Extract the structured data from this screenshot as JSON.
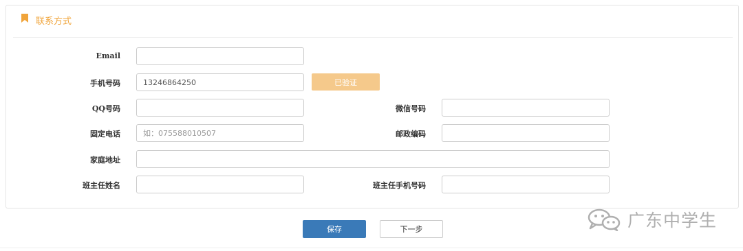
{
  "section": {
    "title": "联系方式",
    "icon": "bookmark-icon",
    "accent_color": "#f0a43a"
  },
  "form": {
    "email": {
      "label": "Email",
      "value": "",
      "placeholder": ""
    },
    "mobile": {
      "label": "手机号码",
      "value": "13246864250",
      "placeholder": ""
    },
    "verify_button": {
      "label": "已验证",
      "color": "#f5c98b"
    },
    "qq": {
      "label": "QQ号码",
      "value": "",
      "placeholder": ""
    },
    "wechat": {
      "label": "微信号码",
      "value": "",
      "placeholder": ""
    },
    "landline": {
      "label": "固定电话",
      "value": "",
      "placeholder": "如：075588010507"
    },
    "postcode": {
      "label": "邮政编码",
      "value": "",
      "placeholder": ""
    },
    "address": {
      "label": "家庭地址",
      "value": "",
      "placeholder": ""
    },
    "teacher_name": {
      "label": "班主任姓名",
      "value": "",
      "placeholder": ""
    },
    "teacher_mobile": {
      "label": "班主任手机号码",
      "value": "",
      "placeholder": ""
    }
  },
  "actions": {
    "save_label": "保存",
    "save_color": "#3a7ab8",
    "next_label": "下一步"
  },
  "watermark": {
    "icon": "wechat-icon",
    "text": "广东中学生"
  }
}
